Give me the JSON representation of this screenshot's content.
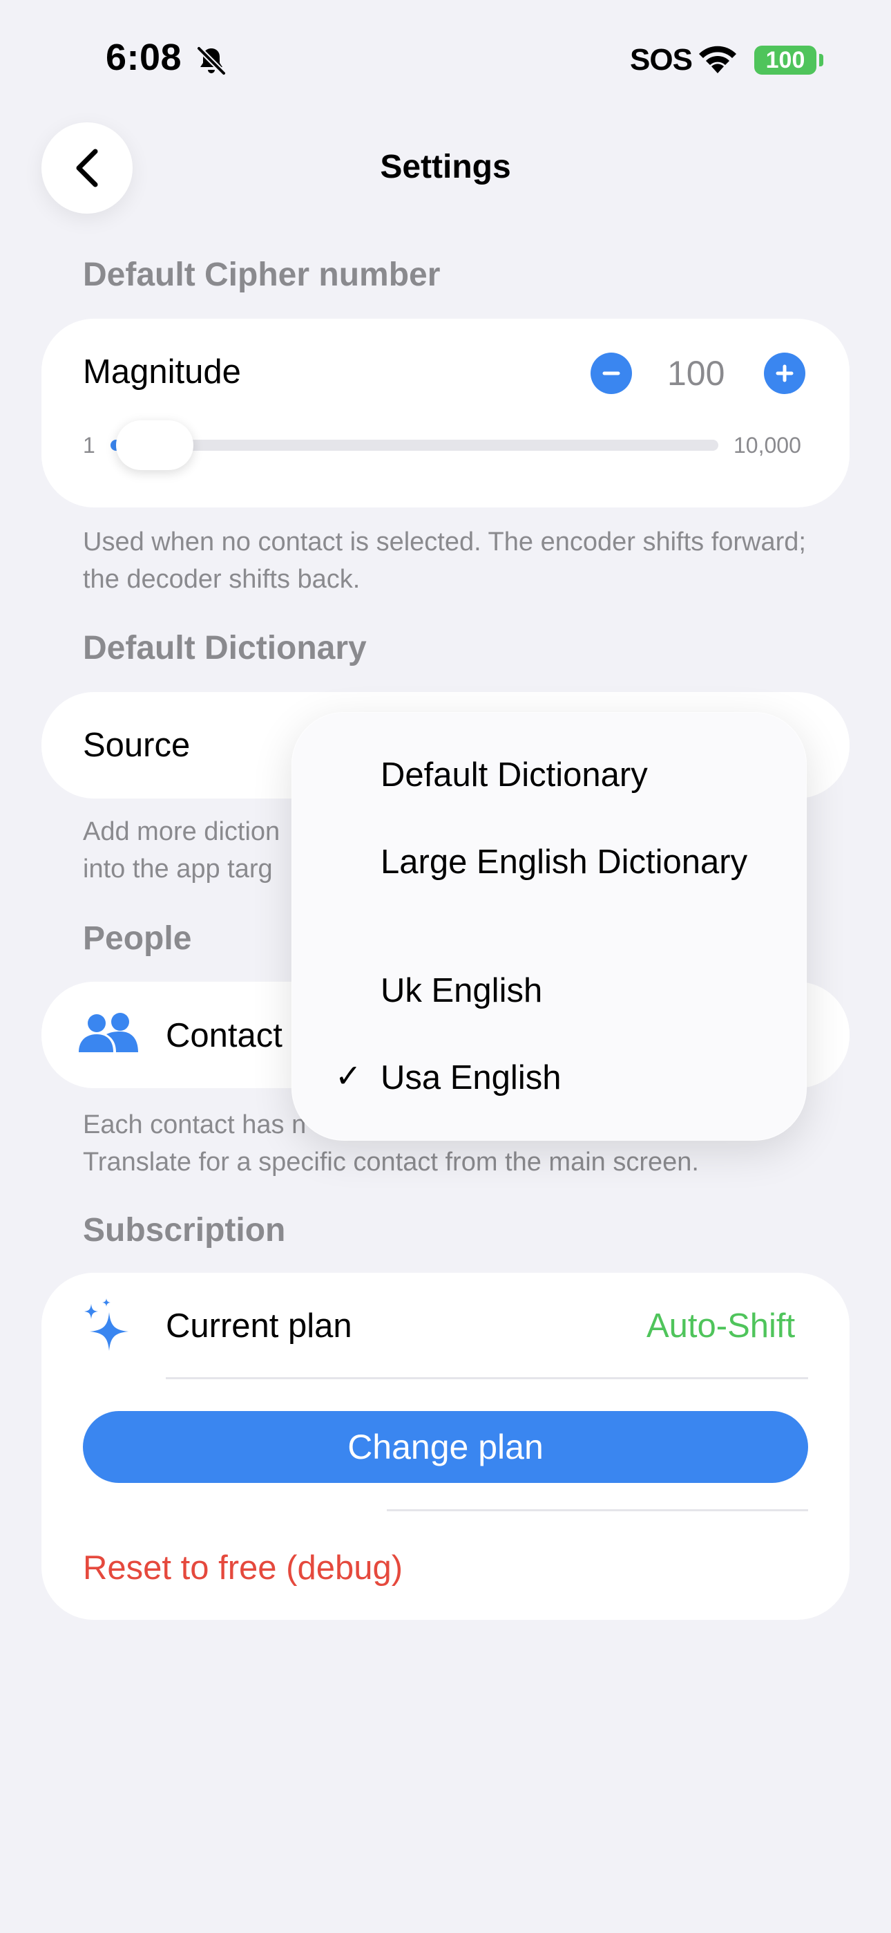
{
  "status_bar": {
    "time": "6:08",
    "sos": "SOS",
    "battery": "100"
  },
  "nav": {
    "title": "Settings"
  },
  "cipher": {
    "section": "Default Cipher number",
    "label": "Magnitude",
    "value": "100",
    "slider_min": "1",
    "slider_max": "10,000",
    "slider_level": 0.01,
    "footnote": "Used when no contact is selected. The encoder shifts forward; the decoder shifts back."
  },
  "dictionary": {
    "section": "Default Dictionary",
    "label": "Source",
    "footnote_partial_1": "Add more diction",
    "footnote_partial_2": "into the app targ",
    "menu": [
      {
        "label": "Default Dictionary",
        "selected": false
      },
      {
        "label": "Large English Dictionary",
        "selected": false
      },
      {
        "label": "Uk English",
        "selected": false
      },
      {
        "label": "Usa English",
        "selected": true
      }
    ],
    "check": "✓"
  },
  "people": {
    "section": "People",
    "label": "Contact",
    "footnote_1": "Each contact has n",
    "footnote_2": "Translate for a specific contact from the main screen."
  },
  "subscription": {
    "section": "Subscription",
    "plan_label": "Current plan",
    "plan_value": "Auto-Shift",
    "change_button": "Change plan",
    "reset_button": "Reset to free (debug)"
  },
  "colors": {
    "accent": "#3a86f0",
    "plan_green": "#4fc45b",
    "destructive": "#e5493d",
    "secondary_text": "#8a8a8e"
  },
  "icons": [
    "bell-slash-icon",
    "wifi-icon",
    "battery-icon",
    "chevron-left-icon",
    "minus-icon",
    "plus-icon",
    "people-icon",
    "sparkles-icon",
    "checkmark-icon"
  ]
}
